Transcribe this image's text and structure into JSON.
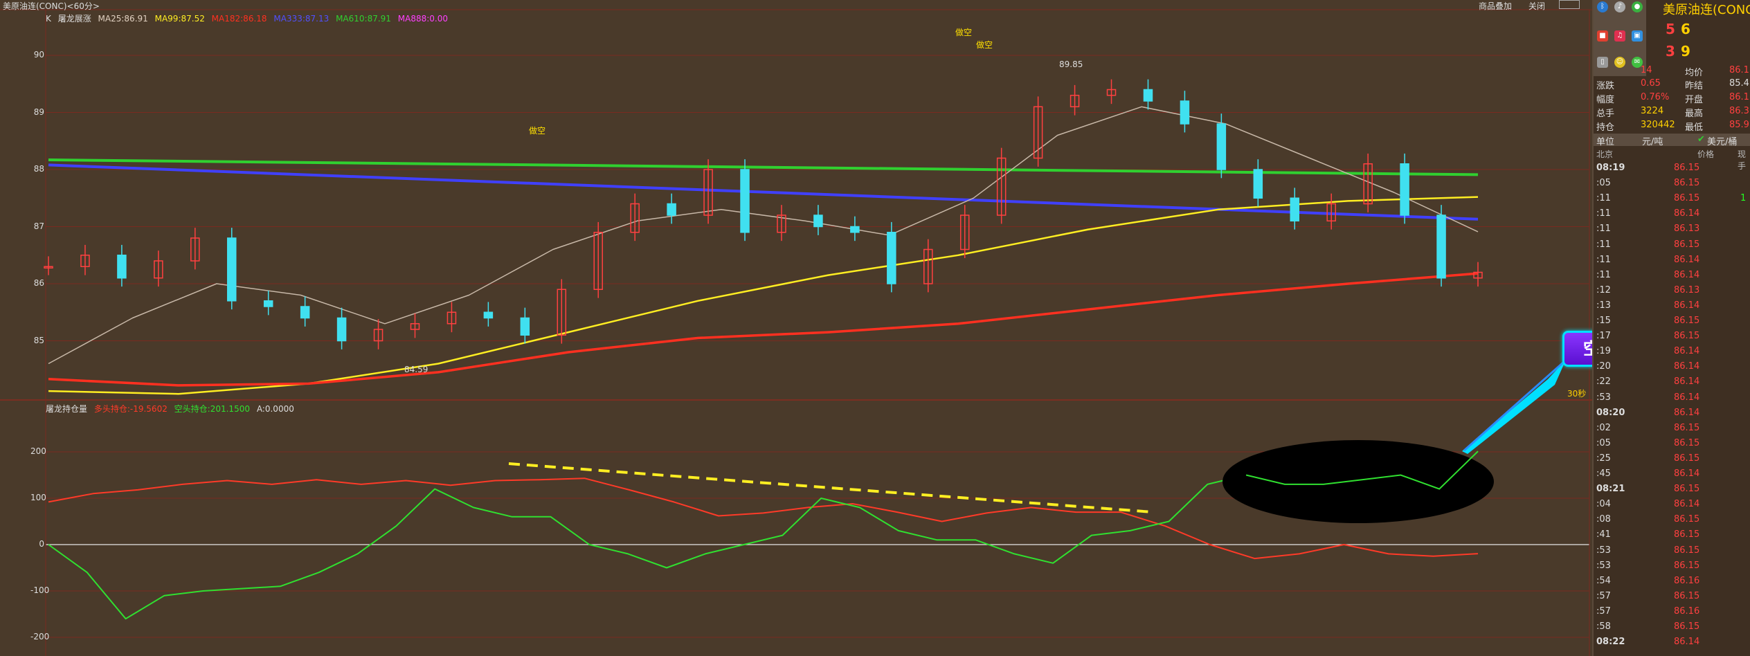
{
  "topbar": {
    "title": "美原油连(CONC)<60分>",
    "btn_add": "商品叠加",
    "btn_close": "关闭"
  },
  "main_legend": {
    "prefix": "K",
    "indicator": "屠龙展涨",
    "ma25": "MA25:86.91",
    "ma99": "MA99:87.52",
    "ma182": "MA182:86.18",
    "ma333": "MA333:87.13",
    "ma610": "MA610:87.91",
    "ma888": "MA888:0.00"
  },
  "sub_legend": {
    "indicator": "屠龙持仓量",
    "long": "多头持仓:-19.5602",
    "short": "空头持仓:201.1500",
    "a": "A:0.0000"
  },
  "y_axis_main": [
    "90",
    "89",
    "88",
    "87",
    "86",
    "85"
  ],
  "y_axis_sub": [
    "200",
    "100",
    "0",
    "-100",
    "-200"
  ],
  "annotations": {
    "short1": "做空",
    "short2": "做空",
    "short3": "做空",
    "high": "89.85",
    "low": "84.59",
    "time_flag": "30秒",
    "callout": "空头主力控盘"
  },
  "colors": {
    "ma25": "#c8b8a8",
    "ma99": "#ffee22",
    "ma182": "#ff3020",
    "ma333": "#4040ff",
    "ma610": "#30d030",
    "up": "#ff4040",
    "down": "#40e0f0",
    "long_line": "#ff3a28",
    "short_line": "#30e030"
  },
  "chart_data": [
    {
      "type": "line",
      "title": "美原油连(CONC)<60分>",
      "ylim": [
        84.4,
        90.6
      ],
      "series": [
        {
          "name": "MA610",
          "values": [
            88.17,
            87.91
          ]
        },
        {
          "name": "MA333",
          "values": [
            88.08,
            87.13
          ]
        },
        {
          "name": "MA99",
          "values": [
            84.12,
            84.07,
            84.25,
            84.6,
            85.15,
            85.7,
            86.15,
            86.5,
            86.95,
            87.3,
            87.45,
            87.52
          ]
        },
        {
          "name": "MA182",
          "values": [
            84.33,
            84.22,
            84.25,
            84.45,
            84.8,
            85.05,
            85.15,
            85.3,
            85.55,
            85.8,
            86.0,
            86.18
          ]
        },
        {
          "name": "MA25",
          "values": [
            84.6,
            85.4,
            86.0,
            85.8,
            85.3,
            85.8,
            86.6,
            87.1,
            87.3,
            87.1,
            86.85,
            87.5,
            88.6,
            89.1,
            88.8,
            88.2,
            87.6,
            86.91
          ]
        }
      ],
      "candles_close": [
        86.3,
        86.5,
        86.1,
        86.4,
        86.8,
        85.7,
        85.6,
        85.4,
        85.0,
        85.2,
        85.3,
        85.5,
        85.4,
        85.1,
        85.9,
        86.9,
        87.4,
        87.2,
        88.0,
        86.9,
        87.2,
        87.0,
        86.9,
        86.0,
        86.6,
        87.2,
        88.2,
        89.1,
        89.3,
        89.4,
        89.2,
        88.8,
        88.0,
        87.5,
        87.1,
        87.4,
        88.1,
        87.2,
        86.1,
        86.2
      ]
    },
    {
      "type": "line",
      "title": "屠龙持仓量",
      "ylim": [
        -240,
        240
      ],
      "series": [
        {
          "name": "多头持仓",
          "values": [
            92,
            110,
            118,
            130,
            138,
            130,
            140,
            130,
            138,
            128,
            138,
            140,
            143,
            118,
            92,
            62,
            68,
            80,
            88,
            70,
            50,
            68,
            80,
            70,
            70,
            40,
            0,
            -30,
            -20,
            0,
            -20,
            -25,
            -19.56
          ]
        },
        {
          "name": "空头持仓",
          "values": [
            0,
            -60,
            -160,
            -110,
            -100,
            -95,
            -90,
            -60,
            -20,
            40,
            120,
            80,
            60,
            60,
            0,
            -20,
            -50,
            -20,
            0,
            20,
            100,
            80,
            30,
            10,
            10,
            -20,
            -40,
            20,
            30,
            50,
            130,
            150,
            130,
            130,
            140,
            150,
            120,
            201.15
          ]
        },
        {
          "name": "A",
          "values": [
            0,
            0
          ]
        }
      ]
    }
  ],
  "panel": {
    "title": "美原油连(CONC)",
    "bid_price": "5",
    "bid_vol": "6",
    "ask_price": "3",
    "ask_vol": "9",
    "row0_val": "14",
    "stats": [
      {
        "l1": "涨跌",
        "v1": "0.65",
        "l2": "昨结",
        "v2": "85.4"
      },
      {
        "l1": "幅度",
        "v1": "0.76%",
        "l2": "开盘",
        "v2": "86.1"
      },
      {
        "l1": "总手",
        "v1": "3224",
        "l2": "最高",
        "v2": "86.3"
      },
      {
        "l1": "持仓",
        "v1": "320442",
        "l2": "最低",
        "v2": "85.9"
      }
    ],
    "avg_label": "均价",
    "avg_value": "86.1",
    "unit_label": "单位",
    "unit_value": "元/吨",
    "currency": "美元/桶",
    "tick_headers": [
      "北京",
      "价格",
      "现手"
    ],
    "ticks": [
      {
        "t": "08:19",
        "p": "86.15",
        "v": ""
      },
      {
        "t": ":05",
        "p": "86.15",
        "v": ""
      },
      {
        "t": ":11",
        "p": "86.15",
        "v": "1"
      },
      {
        "t": ":11",
        "p": "86.14",
        "v": ""
      },
      {
        "t": ":11",
        "p": "86.13",
        "v": ""
      },
      {
        "t": ":11",
        "p": "86.15",
        "v": ""
      },
      {
        "t": ":11",
        "p": "86.14",
        "v": ""
      },
      {
        "t": ":11",
        "p": "86.14",
        "v": ""
      },
      {
        "t": ":12",
        "p": "86.13",
        "v": ""
      },
      {
        "t": ":13",
        "p": "86.14",
        "v": ""
      },
      {
        "t": ":15",
        "p": "86.15",
        "v": ""
      },
      {
        "t": ":17",
        "p": "86.15",
        "v": ""
      },
      {
        "t": ":19",
        "p": "86.14",
        "v": ""
      },
      {
        "t": ":20",
        "p": "86.14",
        "v": ""
      },
      {
        "t": ":22",
        "p": "86.14",
        "v": ""
      },
      {
        "t": ":53",
        "p": "86.14",
        "v": ""
      },
      {
        "t": "08:20",
        "p": "86.14",
        "v": ""
      },
      {
        "t": ":02",
        "p": "86.15",
        "v": ""
      },
      {
        "t": ":05",
        "p": "86.15",
        "v": ""
      },
      {
        "t": ":25",
        "p": "86.15",
        "v": ""
      },
      {
        "t": ":45",
        "p": "86.14",
        "v": ""
      },
      {
        "t": "08:21",
        "p": "86.15",
        "v": ""
      },
      {
        "t": ":04",
        "p": "86.14",
        "v": ""
      },
      {
        "t": ":08",
        "p": "86.15",
        "v": ""
      },
      {
        "t": ":41",
        "p": "86.15",
        "v": ""
      },
      {
        "t": ":53",
        "p": "86.15",
        "v": ""
      },
      {
        "t": ":53",
        "p": "86.15",
        "v": ""
      },
      {
        "t": ":54",
        "p": "86.16",
        "v": ""
      },
      {
        "t": ":57",
        "p": "86.15",
        "v": ""
      },
      {
        "t": ":57",
        "p": "86.16",
        "v": ""
      },
      {
        "t": ":58",
        "p": "86.15",
        "v": ""
      },
      {
        "t": "08:22",
        "p": "86.14",
        "v": ""
      }
    ]
  }
}
